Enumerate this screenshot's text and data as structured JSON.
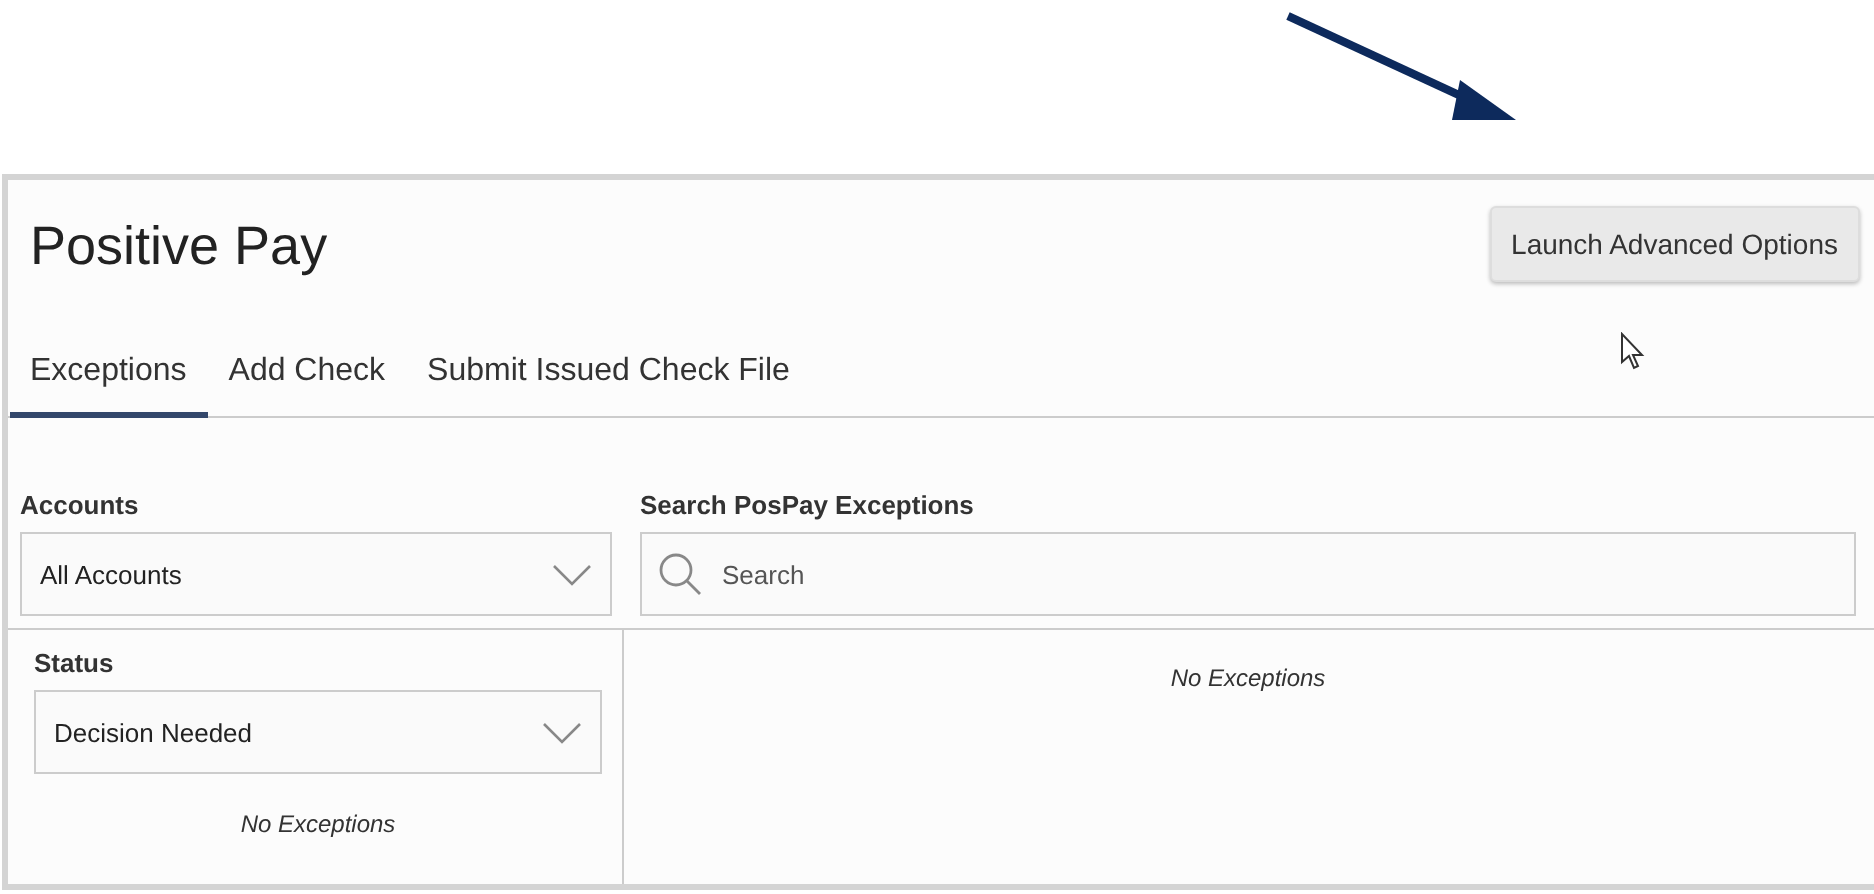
{
  "page": {
    "title": "Positive Pay",
    "action_button": "Launch Advanced Options"
  },
  "tabs": [
    {
      "label": "Exceptions",
      "selected": true
    },
    {
      "label": "Add Check",
      "selected": false
    },
    {
      "label": "Submit Issued Check File",
      "selected": false
    }
  ],
  "accounts": {
    "label": "Accounts",
    "value": "All Accounts"
  },
  "search": {
    "label": "Search PosPay Exceptions",
    "placeholder": "Search"
  },
  "status": {
    "label": "Status",
    "value": "Decision Needed",
    "empty_message": "No Exceptions"
  },
  "results": {
    "empty_message": "No Exceptions"
  }
}
